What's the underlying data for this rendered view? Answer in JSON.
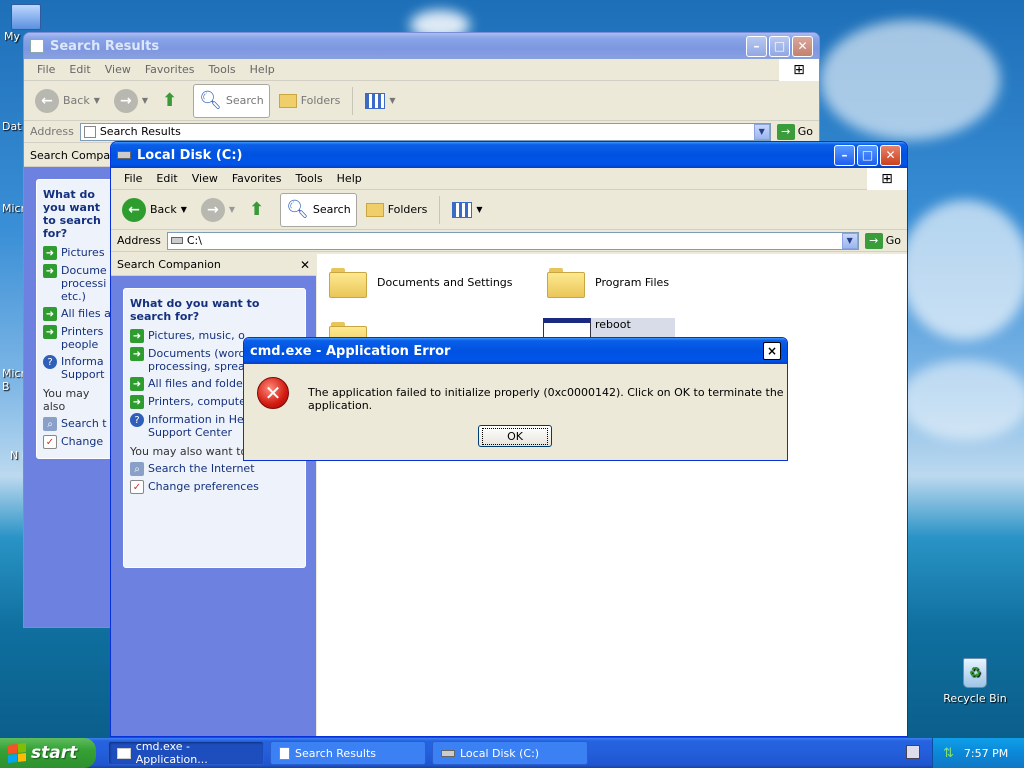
{
  "desktop": {
    "icons": [
      {
        "label": "My"
      },
      {
        "label": "Dat"
      },
      {
        "label": "Micro"
      },
      {
        "label": "Micro B"
      },
      {
        "label": "N D"
      },
      {
        "label": "Recycle Bin"
      }
    ]
  },
  "search_window": {
    "title": "Search Results",
    "menu": [
      "File",
      "Edit",
      "View",
      "Favorites",
      "Tools",
      "Help"
    ],
    "toolbar": {
      "back": "Back",
      "search": "Search",
      "folders": "Folders"
    },
    "address_label": "Address",
    "address_value": "Search Results",
    "go": "Go",
    "companion_title": "Search Companion",
    "panel_heading": "What do you want to search for?",
    "options": [
      "Pictures",
      "Docume processi etc.)",
      "All files a",
      "Printers people",
      "Informa Support"
    ],
    "also": "You may also",
    "links": [
      "Search t",
      "Change"
    ]
  },
  "disk_window": {
    "title": "Local Disk (C:)",
    "menu": [
      "File",
      "Edit",
      "View",
      "Favorites",
      "Tools",
      "Help"
    ],
    "toolbar": {
      "back": "Back",
      "search": "Search",
      "folders": "Folders"
    },
    "address_label": "Address",
    "address_value": "C:\\",
    "go": "Go",
    "companion_title": "Search Companion",
    "panel_heading": "What do you want to search for?",
    "options": [
      "Pictures, music, o",
      "Documents (word processing, sprea etc.)",
      "All files and folder",
      "Printers, compute people",
      "Information in Help and Support Center"
    ],
    "also": "You may also want to...",
    "links": [
      "Search the Internet",
      "Change preferences"
    ],
    "files": [
      "Documents and Settings",
      "Program Files",
      "reboot"
    ]
  },
  "dialog": {
    "title": "cmd.exe - Application Error",
    "message": "The application failed to initialize properly (0xc0000142). Click on OK to terminate the application.",
    "ok": "OK",
    "close": "×"
  },
  "taskbar": {
    "start": "start",
    "items": [
      "cmd.exe - Application...",
      "Search Results",
      "Local Disk (C:)"
    ],
    "clock": "7:57 PM"
  }
}
